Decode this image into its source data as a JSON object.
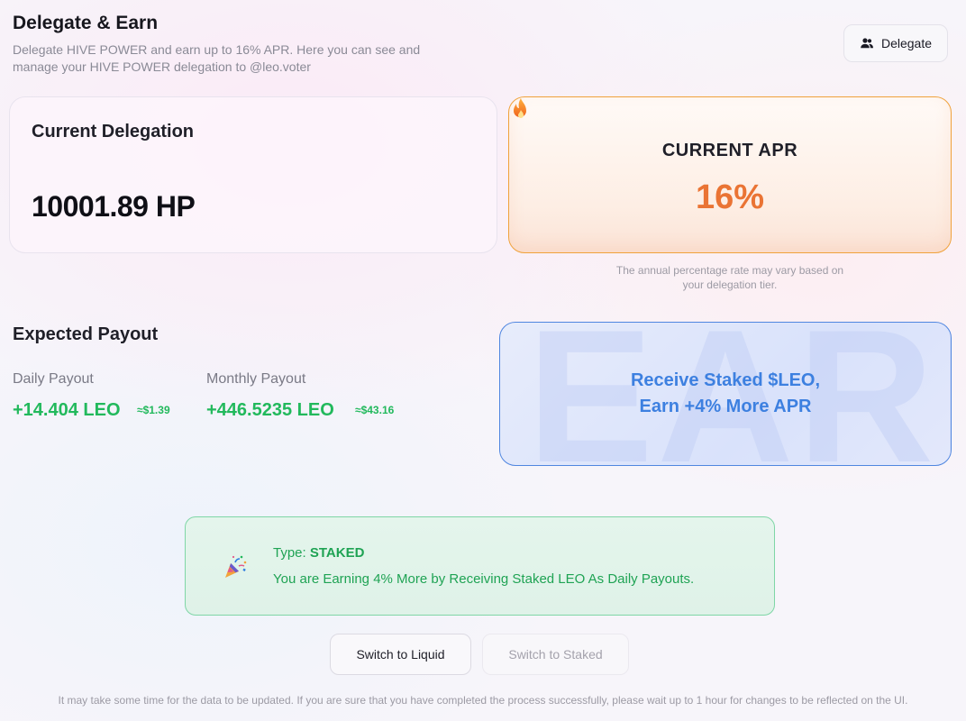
{
  "header": {
    "title": "Delegate & Earn",
    "description": "Delegate HIVE POWER and earn up to 16% APR. Here you can see and manage your HIVE POWER delegation to @leo.voter",
    "delegate_button": "Delegate",
    "delegate_icon": "users-icon"
  },
  "current_delegation": {
    "label": "Current Delegation",
    "value": "10001.89 HP"
  },
  "current_apr": {
    "label": "CURRENT APR",
    "value": "16%",
    "icon": "fire-icon",
    "note": "The annual percentage rate may vary based on your delegation tier."
  },
  "expected_payout": {
    "title": "Expected Payout",
    "daily": {
      "label": "Daily Payout",
      "value": "+14.404 LEO",
      "usd": "≈$1.39"
    },
    "monthly": {
      "label": "Monthly Payout",
      "value": "+446.5235 LEO",
      "usd": "≈$43.16"
    }
  },
  "earn_banner": {
    "background_text": "EARN",
    "line1": "Receive Staked $LEO,",
    "line2": "Earn +4% More APR"
  },
  "payout_type": {
    "icon": "party-popper-icon",
    "type_prefix": "Type: ",
    "type_value": "STAKED",
    "message": "You are Earning 4% More by Receiving Staked LEO As Daily Payouts."
  },
  "switch_buttons": {
    "liquid": "Switch to Liquid",
    "staked": "Switch to Staked"
  },
  "footer_note": "It may take some time for the data to be updated. If you are sure that you have completed the process successfully, please wait up to 1 hour for changes to be reflected on the UI.",
  "colors": {
    "green": "#22b95c",
    "orange": "#ea7434",
    "blue": "#3d80e0"
  }
}
